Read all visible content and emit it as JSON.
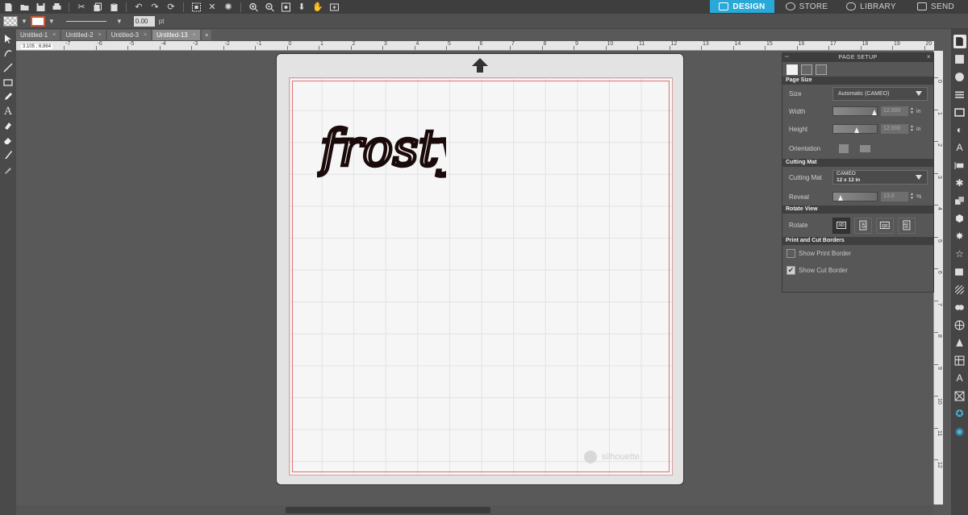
{
  "nav_tabs": [
    {
      "label": "DESIGN",
      "active": true
    },
    {
      "label": "STORE",
      "active": false
    },
    {
      "label": "LIBRARY",
      "active": false
    },
    {
      "label": "SEND",
      "active": false
    }
  ],
  "options_bar": {
    "line_width": "0.00",
    "line_unit": "pt"
  },
  "doc_tabs": [
    {
      "label": "Untitled-1",
      "active": false
    },
    {
      "label": "Untitled-2",
      "active": false
    },
    {
      "label": "Untitled-3",
      "active": false
    },
    {
      "label": "Untitled-13",
      "active": true
    }
  ],
  "add_tab_label": "+",
  "coordinates": "3.105 , 6.864",
  "ruler_top_labels": [
    "-7",
    "-6",
    "-5",
    "-4",
    "-3",
    "-2",
    "-1",
    "0",
    "1",
    "2",
    "3",
    "4",
    "5",
    "6",
    "7",
    "8",
    "9",
    "10",
    "11",
    "12",
    "13",
    "14",
    "15",
    "16",
    "17",
    "18",
    "19",
    "20"
  ],
  "ruler_left_labels": [
    "0",
    "1",
    "2",
    "3",
    "4",
    "5",
    "6",
    "7",
    "8",
    "9",
    "10",
    "11",
    "12"
  ],
  "canvas": {
    "design_text": "frosty",
    "watermark": "silhouette"
  },
  "page_setup": {
    "title": "PAGE SETUP",
    "page_size_header": "Page Size",
    "size_label": "Size",
    "size_value": "Automatic (CAMEO)",
    "width_label": "Width",
    "width_value": "12.000",
    "height_label": "Height",
    "height_value": "12.000",
    "unit_in": "in",
    "orientation_label": "Orientation",
    "cutting_mat_header": "Cutting Mat",
    "cutting_mat_label": "Cutting Mat",
    "cutting_mat_line1": "CAMEO",
    "cutting_mat_line2": "12 x 12 in",
    "reveal_label": "Reveal",
    "reveal_value": "13.0",
    "reveal_unit": "%",
    "rotate_view_header": "Rotate View",
    "rotate_label": "Rotate",
    "print_cut_header": "Print and Cut Borders",
    "show_print_border": "Show Print Border",
    "show_print_border_checked": false,
    "show_cut_border": "Show Cut Border",
    "show_cut_border_checked": true
  },
  "colors": {
    "accent": "#2aa8d8",
    "cut_border": "#e07070",
    "design_fill": "#1a0a0a"
  }
}
